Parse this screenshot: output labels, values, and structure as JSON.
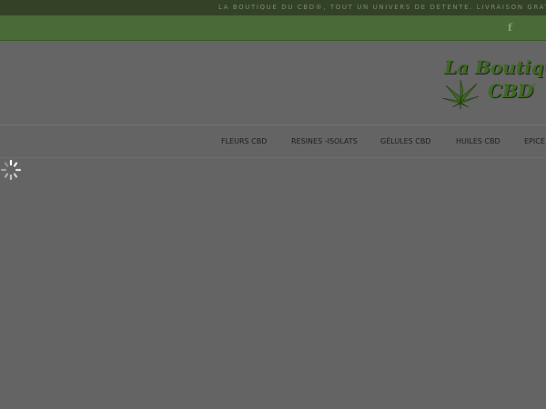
{
  "topbar": {
    "announcement": "LA BOUTIQUE DU CBD®, TOUT UN UNIVERS DE DÉTENTE. LIVRAISON GRATUITE EN F"
  },
  "social": {
    "facebook_glyph": "f"
  },
  "logo": {
    "line1": "La Boutique",
    "line2": "CBD",
    "mark": "®"
  },
  "nav": {
    "items": [
      {
        "label": "FLEURS CBD"
      },
      {
        "label": "RESINES -ISOLATS"
      },
      {
        "label": "GÉLULES CBD"
      },
      {
        "label": "HUILES CBD"
      },
      {
        "label": "EPICE"
      }
    ]
  },
  "colors": {
    "topbar": "#334227",
    "greenbar": "#4a6b38",
    "overlay": "#646464",
    "logo_green": "#3d6a1f"
  }
}
